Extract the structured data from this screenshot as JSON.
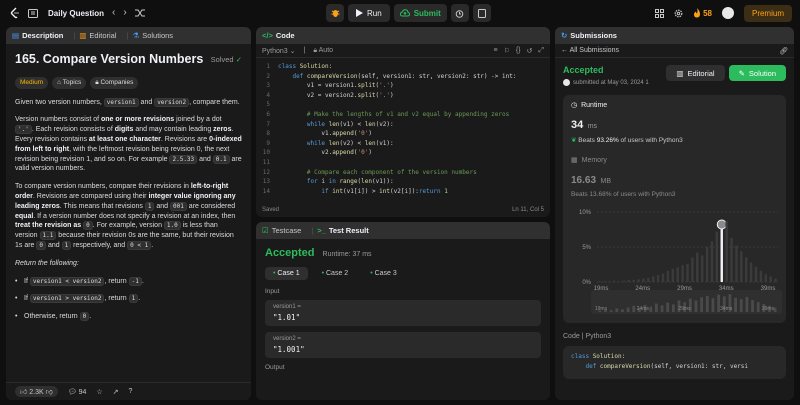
{
  "topbar": {
    "title": "Daily Question",
    "run_label": "Run",
    "submit_label": "Submit",
    "streak": "58",
    "premium_label": "Premium"
  },
  "desc": {
    "tabs": [
      "Description",
      "Editorial",
      "Solutions"
    ],
    "title": "165. Compare Version Numbers",
    "solved": "Solved",
    "tags": [
      "Medium",
      "Topics",
      "Companies"
    ],
    "p1": [
      "Given two version numbers, ",
      "version1",
      " and ",
      "version2",
      ", compare them."
    ],
    "p2": [
      "Version numbers consist of ",
      "one or more revisions",
      " joined by a dot ",
      "'.'",
      ". Each revision consists of ",
      "digits",
      " and may contain leading ",
      "zeros",
      ". Every revision contains ",
      "at least one character",
      ". Revisions are ",
      "0-indexed from left to right",
      ", with the leftmost revision being revision 0, the next revision being revision 1, and so on. For example ",
      "2.5.33",
      " and ",
      "0.1",
      " are valid version numbers."
    ],
    "p3": [
      "To compare version numbers, compare their revisions in ",
      "left-to-right order",
      ". Revisions are compared using their ",
      "integer value ignoring any leading zeros",
      ". This means that revisions ",
      "1",
      " and ",
      "001",
      " are considered ",
      "equal",
      ". If a version number does not specify a revision at an index, then ",
      "treat the revision as ",
      "0",
      ". For example, version ",
      "1.0",
      " is less than version ",
      "1.1",
      " because their revision 0s are the same, but their revision 1s are ",
      "0",
      " and ",
      "1",
      " respectively, and ",
      "0 < 1",
      "."
    ],
    "return_label": "Return the following:",
    "bullets": [
      [
        "If ",
        "version1 < version2",
        ", return ",
        "-1",
        "."
      ],
      [
        "If ",
        "version1 > version2",
        ", return ",
        "1",
        "."
      ],
      [
        "Otherwise, return ",
        "0",
        "."
      ]
    ],
    "likes": "2.3K",
    "comments": "94"
  },
  "code": {
    "tab": "Code",
    "language": "Python3",
    "autosave": "Auto",
    "saved": "Saved",
    "cursor": "Ln 11, Col 5",
    "line_numbers": [
      "1",
      "2",
      "3",
      "4",
      "5",
      "6",
      "7",
      "8",
      "9",
      "10",
      "11",
      "12",
      "13",
      "14"
    ],
    "lines": [
      [
        [
          "kw",
          "class "
        ],
        [
          "fn",
          "Solution"
        ],
        [
          "pn",
          ":"
        ]
      ],
      [
        [
          "pn",
          "    "
        ],
        [
          "kw",
          "def "
        ],
        [
          "fn",
          "compareVersion"
        ],
        [
          "pn",
          "(self, version1: str, version2: str) -> int:"
        ]
      ],
      [
        [
          "pn",
          "        v1 = version1."
        ],
        [
          "fn",
          "split"
        ],
        [
          "pn",
          "("
        ],
        [
          "st",
          "'.'"
        ],
        [
          "pn",
          ")"
        ]
      ],
      [
        [
          "pn",
          "        v2 = version2."
        ],
        [
          "fn",
          "split"
        ],
        [
          "pn",
          "("
        ],
        [
          "st",
          "'.'"
        ],
        [
          "pn",
          ")"
        ]
      ],
      [],
      [
        [
          "cm",
          "        # Make the lengths of v1 and v2 equal by appending zeros"
        ]
      ],
      [
        [
          "pn",
          "        "
        ],
        [
          "kw",
          "while "
        ],
        [
          "fn",
          "len"
        ],
        [
          "pn",
          "(v1) < "
        ],
        [
          "fn",
          "len"
        ],
        [
          "pn",
          "(v2):"
        ]
      ],
      [
        [
          "pn",
          "            v1."
        ],
        [
          "fn",
          "append"
        ],
        [
          "pn",
          "("
        ],
        [
          "st",
          "'0'"
        ],
        [
          "pn",
          ")"
        ]
      ],
      [
        [
          "pn",
          "        "
        ],
        [
          "kw",
          "while "
        ],
        [
          "fn",
          "len"
        ],
        [
          "pn",
          "(v2) < "
        ],
        [
          "fn",
          "len"
        ],
        [
          "pn",
          "(v1):"
        ]
      ],
      [
        [
          "pn",
          "            v2."
        ],
        [
          "fn",
          "append"
        ],
        [
          "pn",
          "("
        ],
        [
          "st",
          "'0'"
        ],
        [
          "pn",
          ")"
        ]
      ],
      [],
      [
        [
          "cm",
          "        # Compare each component of the version numbers"
        ]
      ],
      [
        [
          "pn",
          "        "
        ],
        [
          "kw",
          "for "
        ],
        [
          "pn",
          "i "
        ],
        [
          "kw",
          "in "
        ],
        [
          "fn",
          "range"
        ],
        [
          "pn",
          "("
        ],
        [
          "fn",
          "len"
        ],
        [
          "pn",
          "(v1)):"
        ]
      ],
      [
        [
          "pn",
          "            "
        ],
        [
          "kw",
          "if "
        ],
        [
          "fn",
          "int"
        ],
        [
          "pn",
          "(v1[i]) > "
        ],
        [
          "fn",
          "int"
        ],
        [
          "pn",
          "(v2[i]):"
        ],
        [
          "kw",
          "return "
        ],
        [
          "nm",
          "1"
        ]
      ]
    ]
  },
  "testresult": {
    "tabs": [
      "Testcase",
      "Test Result"
    ],
    "status": "Accepted",
    "runtime": "Runtime: 37 ms",
    "cases": [
      "Case 1",
      "Case 2",
      "Case 3"
    ],
    "input_label": "Input",
    "inputs": [
      {
        "name": "version1 =",
        "value": "\"1.01\""
      },
      {
        "name": "version2 =",
        "value": "\"1.001\""
      }
    ],
    "output_label": "Output"
  },
  "submissions": {
    "tab": "Submissions",
    "back_label": "All Submissions",
    "status": "Accepted",
    "submitted": "submitted at May 03, 2024 1",
    "editorial_label": "Editorial",
    "solution_label": "Solution",
    "runtime_label": "Runtime",
    "runtime_value": "34",
    "runtime_unit": "ms",
    "runtime_beats_pre": "Beats ",
    "runtime_beats_pct": "93.26%",
    "runtime_beats_post": " of users with Python3",
    "memory_label": "Memory",
    "memory_value": "16.63",
    "memory_unit": "MB",
    "memory_beats": "Beats 13.68% of users with Python3",
    "code_label": "Code",
    "code_lang": "Python3",
    "code_lines": [
      [
        [
          "kw",
          "class "
        ],
        [
          "fn",
          "Solution"
        ],
        [
          "pn",
          ":"
        ]
      ],
      [
        [
          "pn",
          "    "
        ],
        [
          "kw",
          "def "
        ],
        [
          "fn",
          "compareVersion"
        ],
        [
          "pn",
          "(self, version1: str, versi"
        ]
      ]
    ],
    "colors": {
      "accent": "#2cbb5d",
      "highlight": "#eff1f6",
      "bar": "#3b3b3b"
    }
  },
  "chart_data": {
    "type": "bar",
    "ylabel": "",
    "yticks": [
      "10%",
      "5%",
      "0%"
    ],
    "ylim": [
      0,
      10
    ],
    "xticks": [
      "19ms",
      "24ms",
      "29ms",
      "34ms",
      "39ms"
    ],
    "values": [
      0.1,
      0.1,
      0.1,
      0.2,
      0.1,
      0.2,
      0.3,
      0.3,
      0.4,
      0.5,
      0.6,
      0.8,
      1.0,
      1.2,
      1.6,
      1.9,
      2.1,
      2.4,
      2.6,
      3.5,
      4.2,
      3.8,
      5.0,
      5.8,
      7.2,
      8.5,
      8.7,
      6.3,
      5.2,
      4.4,
      3.5,
      2.8,
      2.2,
      1.6,
      1.1,
      0.8,
      0.5
    ],
    "highlight_index": 25,
    "mini_values": [
      0.3,
      0.5,
      0.4,
      0.8,
      0.6,
      1.0,
      1.4,
      0.9,
      1.6,
      1.2,
      1.9,
      1.5,
      2.1,
      1.7,
      2.6,
      2.2,
      3.0,
      2.6,
      3.3,
      3.6,
      3.1,
      3.9,
      3.5,
      4.0,
      3.2,
      2.9,
      3.4,
      2.7,
      2.2,
      1.8,
      1.4,
      1.0
    ]
  }
}
